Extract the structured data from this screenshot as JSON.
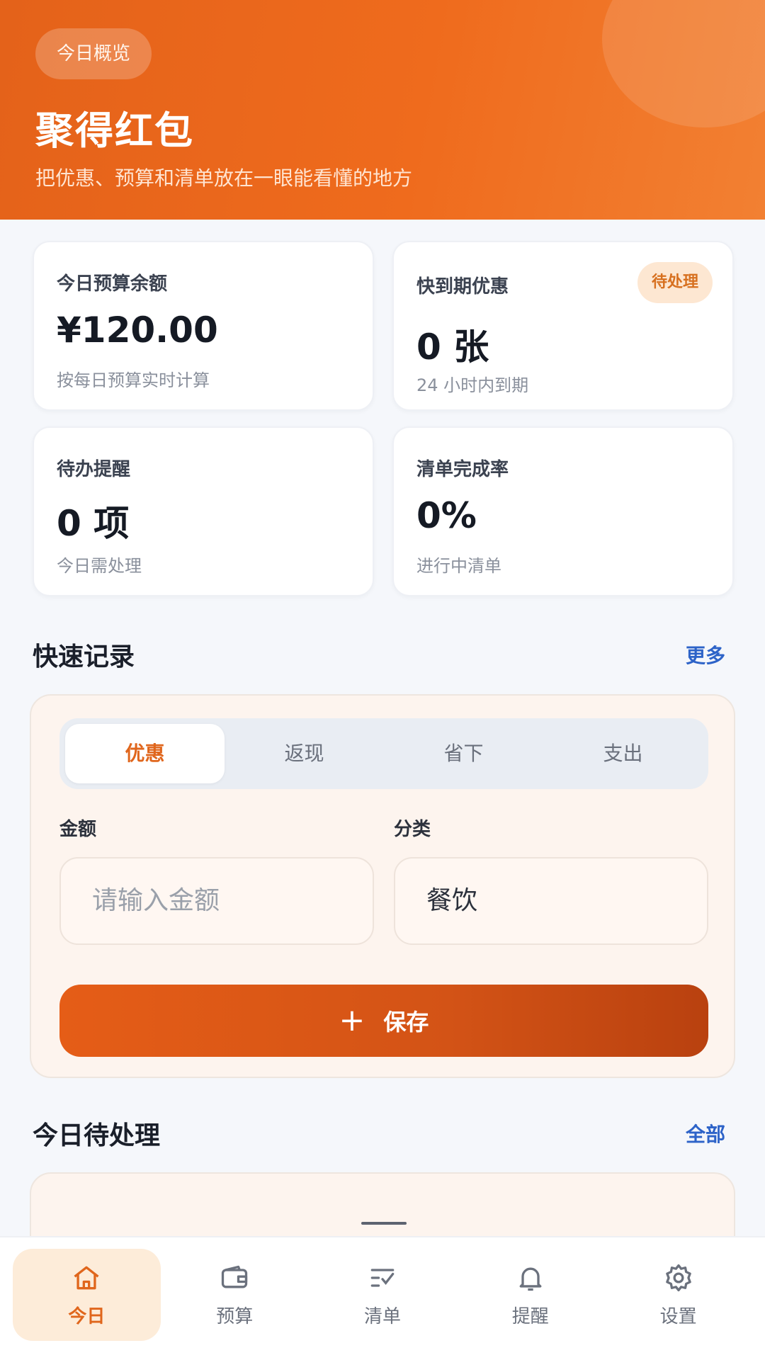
{
  "hero": {
    "chip": "今日概览",
    "title": "聚得红包",
    "subtitle": "把优惠、预算和清单放在一眼能看懂的地方"
  },
  "stats": [
    {
      "label": "今日预算余额",
      "value": "¥120.00",
      "note": "按每日预算实时计算"
    },
    {
      "label": "快到期优惠",
      "value": "0 张",
      "note": "24 小时内到期",
      "badge": "待处理"
    },
    {
      "label": "待办提醒",
      "value": "0 项",
      "note": "今日需处理"
    },
    {
      "label": "清单完成率",
      "value": "0%",
      "note": "进行中清单"
    }
  ],
  "quick_record": {
    "title": "快速记录",
    "more_link": "更多",
    "tabs": [
      "优惠",
      "返现",
      "省下",
      "支出"
    ],
    "active_tab": "优惠",
    "amount_label": "金额",
    "amount_placeholder": "请输入金额",
    "category_label": "分类",
    "category_value": "餐饮",
    "save_label": "保存"
  },
  "today_pending": {
    "title": "今日待处理",
    "all_link": "全部"
  },
  "tabbar": [
    {
      "label": "今日",
      "icon": "home-icon",
      "active": true
    },
    {
      "label": "预算",
      "icon": "wallet-icon",
      "active": false
    },
    {
      "label": "清单",
      "icon": "checklist-icon",
      "active": false
    },
    {
      "label": "提醒",
      "icon": "bell-icon",
      "active": false
    },
    {
      "label": "设置",
      "icon": "gear-icon",
      "active": false
    }
  ],
  "colors": {
    "brand": "#ef6b1d",
    "link": "#2d63c8",
    "badge_bg": "#fde7d2"
  }
}
